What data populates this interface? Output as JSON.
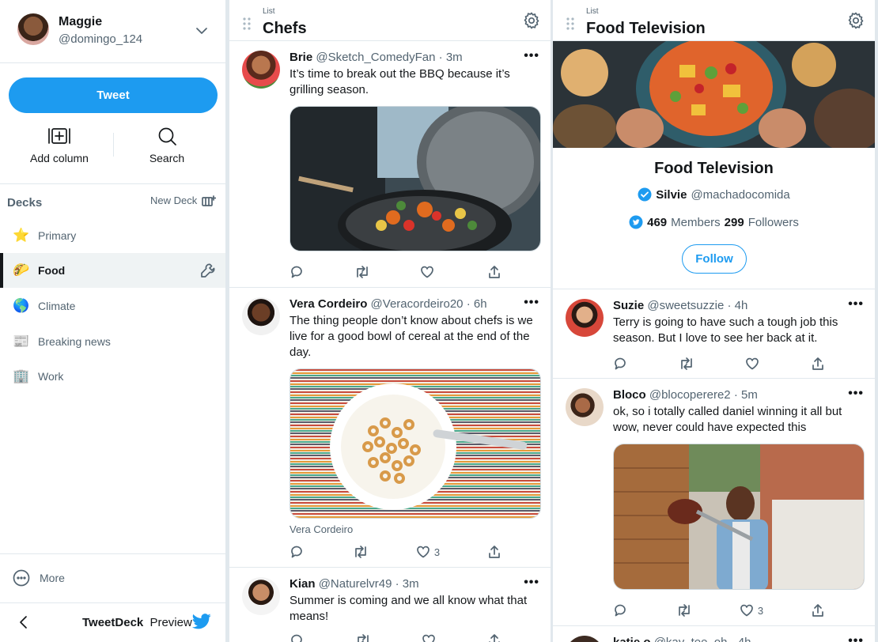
{
  "account": {
    "name": "Maggie",
    "handle": "@domingo_124"
  },
  "sidebar": {
    "tweet_label": "Tweet",
    "add_column_label": "Add column",
    "search_label": "Search",
    "decks_title": "Decks",
    "new_deck_label": "New Deck",
    "decks": [
      {
        "label": "Primary",
        "emoji": "⭐"
      },
      {
        "label": "Food",
        "emoji": "🌮"
      },
      {
        "label": "Climate",
        "emoji": "🌎"
      },
      {
        "label": "Breaking news",
        "emoji": "📰"
      },
      {
        "label": "Work",
        "emoji": "🏢"
      }
    ],
    "active_deck": "Food",
    "more_label": "More",
    "brand": "TweetDeck",
    "brand_suffix": "Preview"
  },
  "columns": [
    {
      "type": "List",
      "title": "Chefs",
      "tweets": [
        {
          "name": "Brie",
          "handle": "@Sketch_ComedyFan",
          "time": "· 3m",
          "text": "It’s time to break out the BBQ because it’s grilling season.",
          "likes": ""
        },
        {
          "name": "Vera Cordeiro",
          "handle": "@Veracordeiro20",
          "time": "· 6h",
          "text": "The thing people don’t know about chefs is we live for a good bowl of cereal at the end of the day.",
          "caption": "Vera Cordeiro",
          "likes": "3"
        },
        {
          "name": "Kian",
          "handle": "@Naturelvr49",
          "time": "· 3m",
          "text": "Summer is coming and we all know what that means!",
          "likes": ""
        }
      ]
    },
    {
      "type": "List",
      "title": "Food Television",
      "list_profile": {
        "name": "Food Television",
        "owner_name": "Silvie",
        "owner_handle": "@machadocomida",
        "members_count": "469",
        "members_label": "Members",
        "followers_count": "299",
        "followers_label": "Followers",
        "follow_label": "Follow"
      },
      "tweets": [
        {
          "name": "Suzie",
          "handle": "@sweetsuzzie",
          "time": "· 4h",
          "text": "Terry is going to have such a tough job this season. But I love to see her back at it.",
          "likes": ""
        },
        {
          "name": "Bloco",
          "handle": "@blocoperere2",
          "time": "· 5m",
          "text": "ok, so i totally called daniel winning it all but wow, never could have expected this",
          "likes": "3"
        },
        {
          "name": "katie o",
          "handle": "@kay_tee_oh",
          "time": "· 4h",
          "text": "",
          "likes": ""
        }
      ]
    }
  ],
  "colors": {
    "accent": "#1d9bf0",
    "text": "#14171a",
    "muted": "#536471",
    "border": "#e1e8ed"
  }
}
